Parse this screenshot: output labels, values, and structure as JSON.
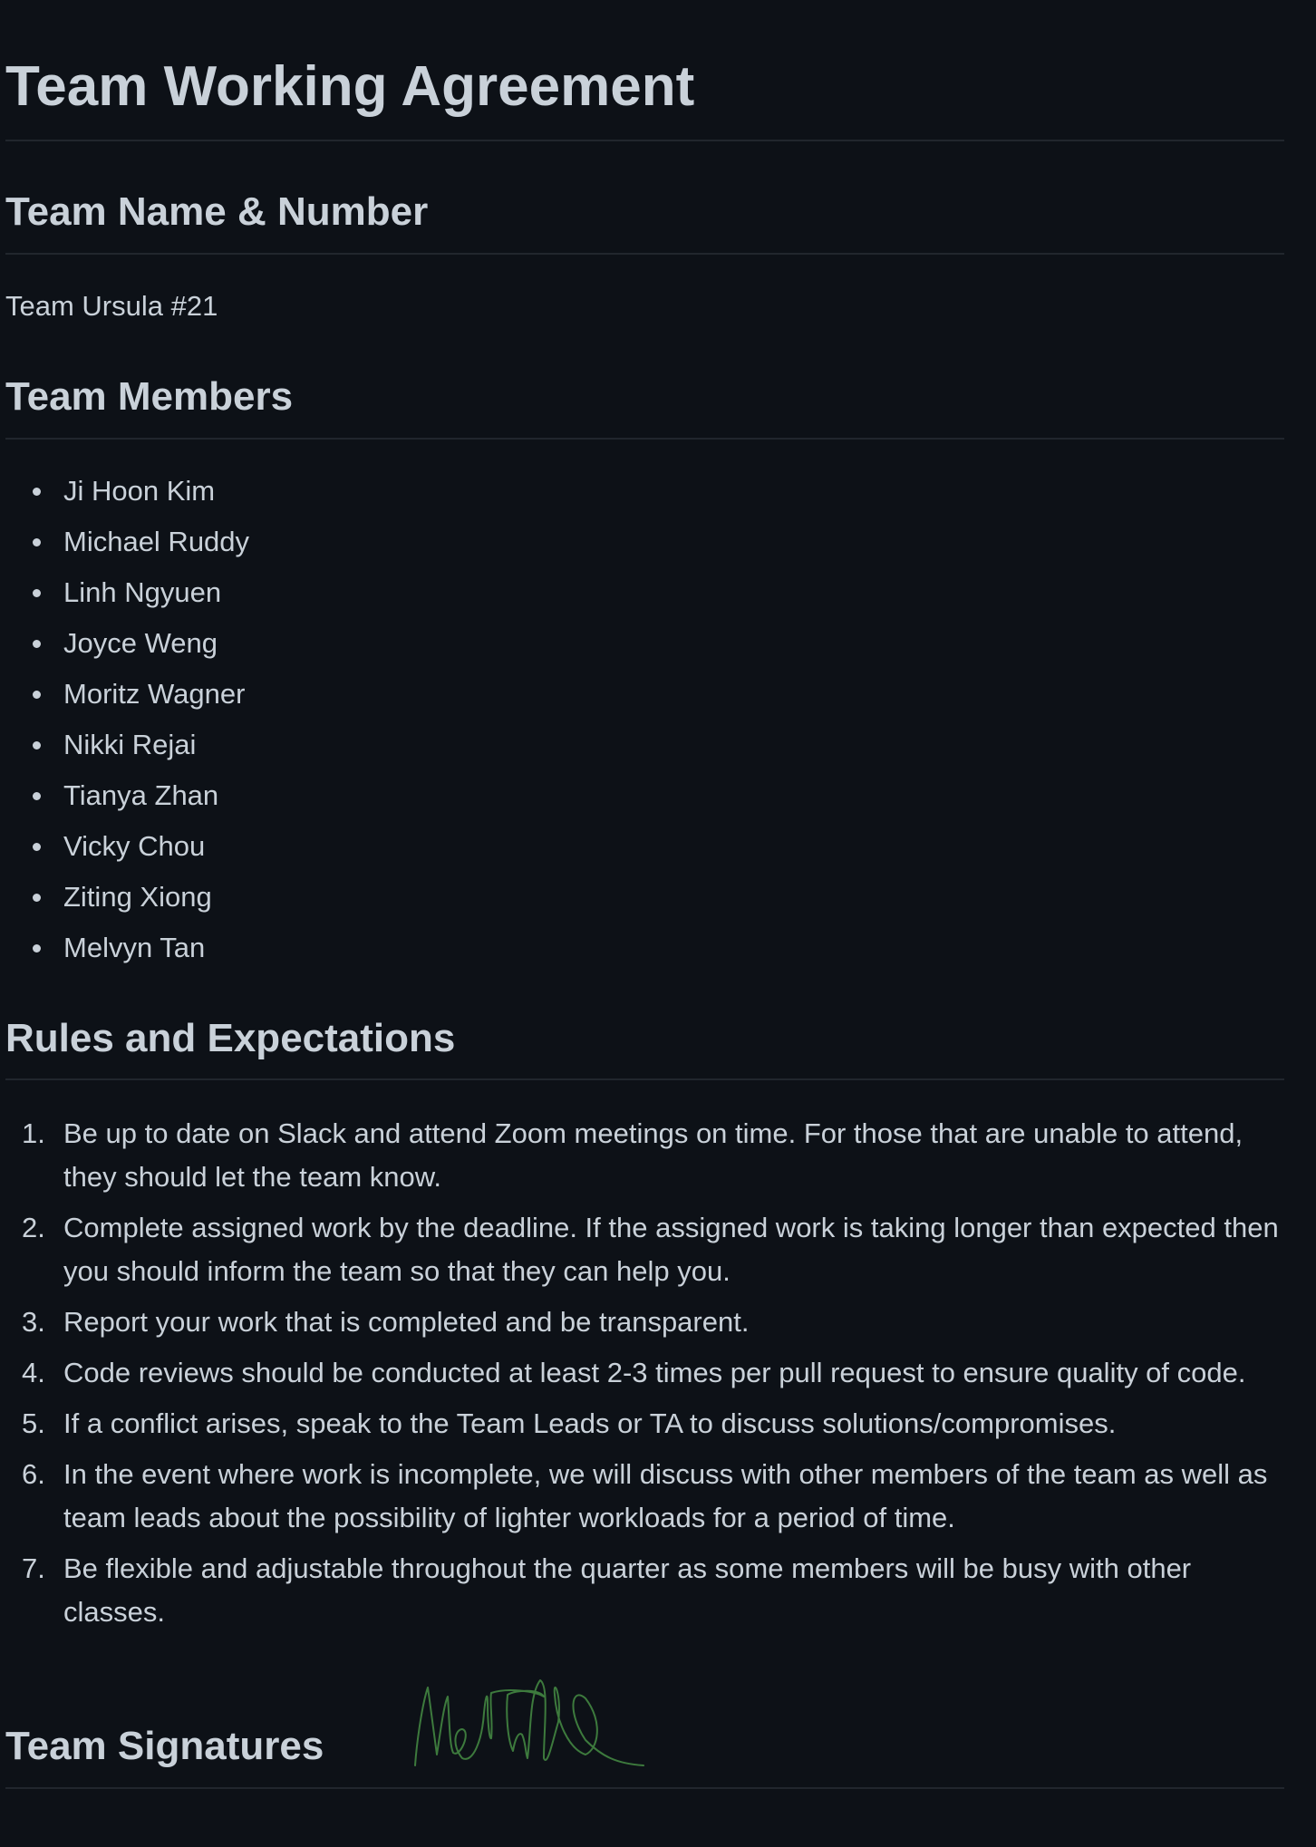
{
  "title": "Team Working Agreement",
  "team_name_section": {
    "heading": "Team Name & Number",
    "value": "Team Ursula #21"
  },
  "members_section": {
    "heading": "Team Members",
    "members": [
      "Ji Hoon Kim",
      "Michael Ruddy",
      "Linh Ngyuen",
      "Joyce Weng",
      "Moritz Wagner",
      "Nikki Rejai",
      "Tianya Zhan",
      "Vicky Chou",
      "Ziting Xiong",
      "Melvyn Tan"
    ]
  },
  "rules_section": {
    "heading": "Rules and Expectations",
    "rules": [
      {
        "num": "1.",
        "text": "Be up to date on Slack and attend Zoom meetings on time. For those that are unable to attend, they should let the team know."
      },
      {
        "num": "2.",
        "text": "Complete assigned work by the deadline. If the assigned work is taking longer than expected then you should inform the team so that they can help you."
      },
      {
        "num": "3.",
        "text": "Report your work that is completed and be transparent."
      },
      {
        "num": "4.",
        "text": "Code reviews should be conducted at least 2-3 times per pull request to ensure quality of code."
      },
      {
        "num": "5.",
        "text": "If a conflict arises, speak to the Team Leads or TA to discuss solutions/compromises."
      },
      {
        "num": "6.",
        "text": "In the event where work is incomplete, we will discuss with other members of the team as well as team leads about the possibility of lighter workloads for a period of time."
      },
      {
        "num": "7.",
        "text": "Be flexible and adjustable throughout the quarter as some members will be busy with other classes."
      }
    ]
  },
  "signatures_section": {
    "heading": "Team Signatures",
    "signature_color": "#3d7a3d"
  },
  "colors": {
    "background": "#0d1117",
    "text": "#c9d1d9",
    "divider": "#21262d"
  }
}
